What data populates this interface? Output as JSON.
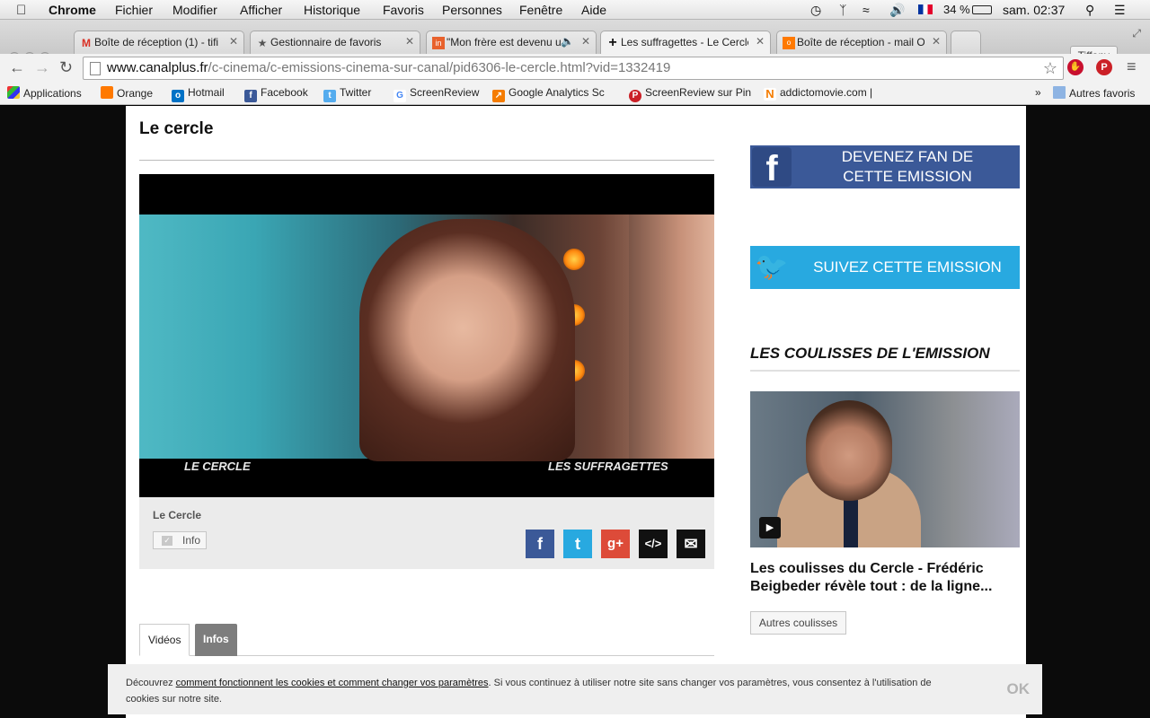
{
  "menubar": {
    "app": "Chrome",
    "items": [
      "Fichier",
      "Modifier",
      "Afficher",
      "Historique",
      "Favoris",
      "Personnes",
      "Fenêtre",
      "Aide"
    ],
    "battery": "34 %",
    "clock": "sam. 02:37"
  },
  "tabs": [
    {
      "label": "Boîte de réception (1) - tifi",
      "icon": "gmail-icon"
    },
    {
      "label": "Gestionnaire de favoris",
      "icon": "star-icon"
    },
    {
      "label": "\"Mon frère est devenu u",
      "icon": "audio-icon"
    },
    {
      "label": "Les suffragettes - Le Cercle",
      "icon": "canalplus-icon"
    },
    {
      "label": "Boîte de réception - mail O",
      "icon": "orange-icon"
    }
  ],
  "profile": "Tiffany",
  "omnibox": {
    "host": "www.canalplus.fr",
    "path": "/c-cinema/c-emissions-cinema-sur-canal/pid6306-le-cercle.html?vid=1332419"
  },
  "bookmarks": {
    "items": [
      "Applications",
      "Orange",
      "Hotmail",
      "Facebook",
      "Twitter",
      "ScreenReview",
      "Google Analytics Sc",
      "ScreenReview sur Pin",
      "addictomovie.com |"
    ],
    "overflow": "»",
    "other": "Autres favoris"
  },
  "page": {
    "title": "Le cercle",
    "video_captions": {
      "left": "LE CERCLE",
      "right": "LES SUFFRAGETTES"
    },
    "meta_title": "Le Cercle",
    "info_button": "Info",
    "share": [
      "f",
      "t",
      "g+",
      "</>",
      "✉"
    ],
    "tab_videos": "Vidéos",
    "tab_infos": "Infos"
  },
  "sidebar": {
    "facebook_banner": [
      "DEVENEZ FAN DE",
      "CETTE EMISSION"
    ],
    "twitter_banner": "SUIVEZ CETTE EMISSION",
    "coulisses_heading": "LES COULISSES DE L'EMISSION",
    "coulisses_title": "Les coulisses du Cercle - Frédéric Beigbeder révèle tout : de la ligne...",
    "autres_button": "Autres coulisses"
  },
  "cookie": {
    "prefix": "Découvrez ",
    "link": "comment fonctionnent les cookies et comment changer vos paramètres",
    "suffix": ". Si vous continuez à utiliser notre site sans changer vos paramètres, vous consentez à l'utilisation de cookies sur notre site.",
    "ok": "OK"
  },
  "colors": {
    "facebook": "#3b5998",
    "twitter": "#28a9e0",
    "googleplus": "#dd4b39",
    "embed": "#111111",
    "mail": "#111111"
  }
}
